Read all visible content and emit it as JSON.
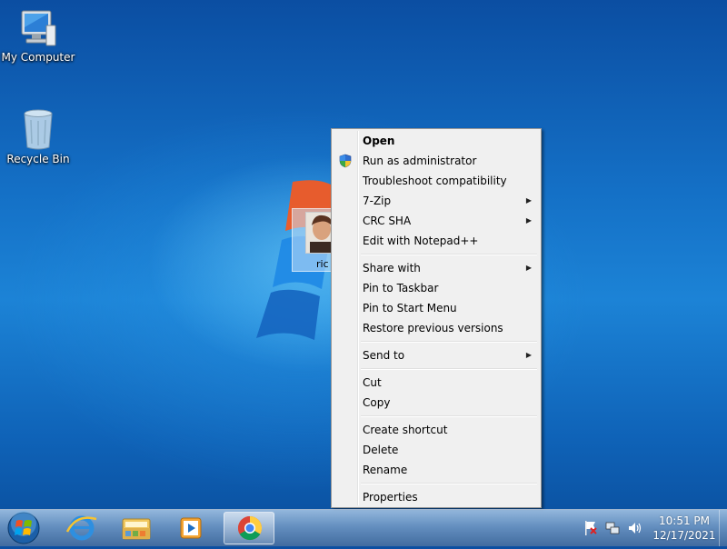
{
  "desktop": {
    "icons": [
      {
        "label": "My Computer",
        "icon": "computer-icon"
      },
      {
        "label": "Recycle Bin",
        "icon": "recycle-bin-icon"
      }
    ],
    "selected_file": {
      "label": "ric",
      "icon": "image-thumbnail-icon"
    }
  },
  "context_menu": {
    "items": [
      {
        "label": "Open",
        "bold": true
      },
      {
        "label": "Run as administrator",
        "icon": "uac-shield-icon"
      },
      {
        "label": "Troubleshoot compatibility"
      },
      {
        "label": "7-Zip",
        "submenu": true
      },
      {
        "label": "CRC SHA",
        "submenu": true
      },
      {
        "label": "Edit with Notepad++"
      },
      {
        "label": "Share with",
        "submenu": true
      },
      {
        "label": "Pin to Taskbar"
      },
      {
        "label": "Pin to Start Menu"
      },
      {
        "label": "Restore previous versions"
      },
      {
        "label": "Send to",
        "submenu": true
      },
      {
        "label": "Cut"
      },
      {
        "label": "Copy"
      },
      {
        "label": "Create shortcut"
      },
      {
        "label": "Delete"
      },
      {
        "label": "Rename"
      },
      {
        "label": "Properties"
      }
    ]
  },
  "taskbar": {
    "start_icon": "windows-start-orb-icon",
    "pinned": [
      {
        "name": "Internet Explorer",
        "icon": "internet-explorer-icon"
      },
      {
        "name": "Windows Explorer",
        "icon": "folder-library-icon"
      },
      {
        "name": "Windows Media Player",
        "icon": "media-player-icon"
      },
      {
        "name": "Google Chrome",
        "icon": "chrome-icon",
        "active": true
      }
    ],
    "tray_icons": [
      "action-center-flag-icon",
      "network-icon",
      "volume-icon"
    ],
    "clock": {
      "time": "10:51 PM",
      "date": "12/17/2021"
    }
  }
}
